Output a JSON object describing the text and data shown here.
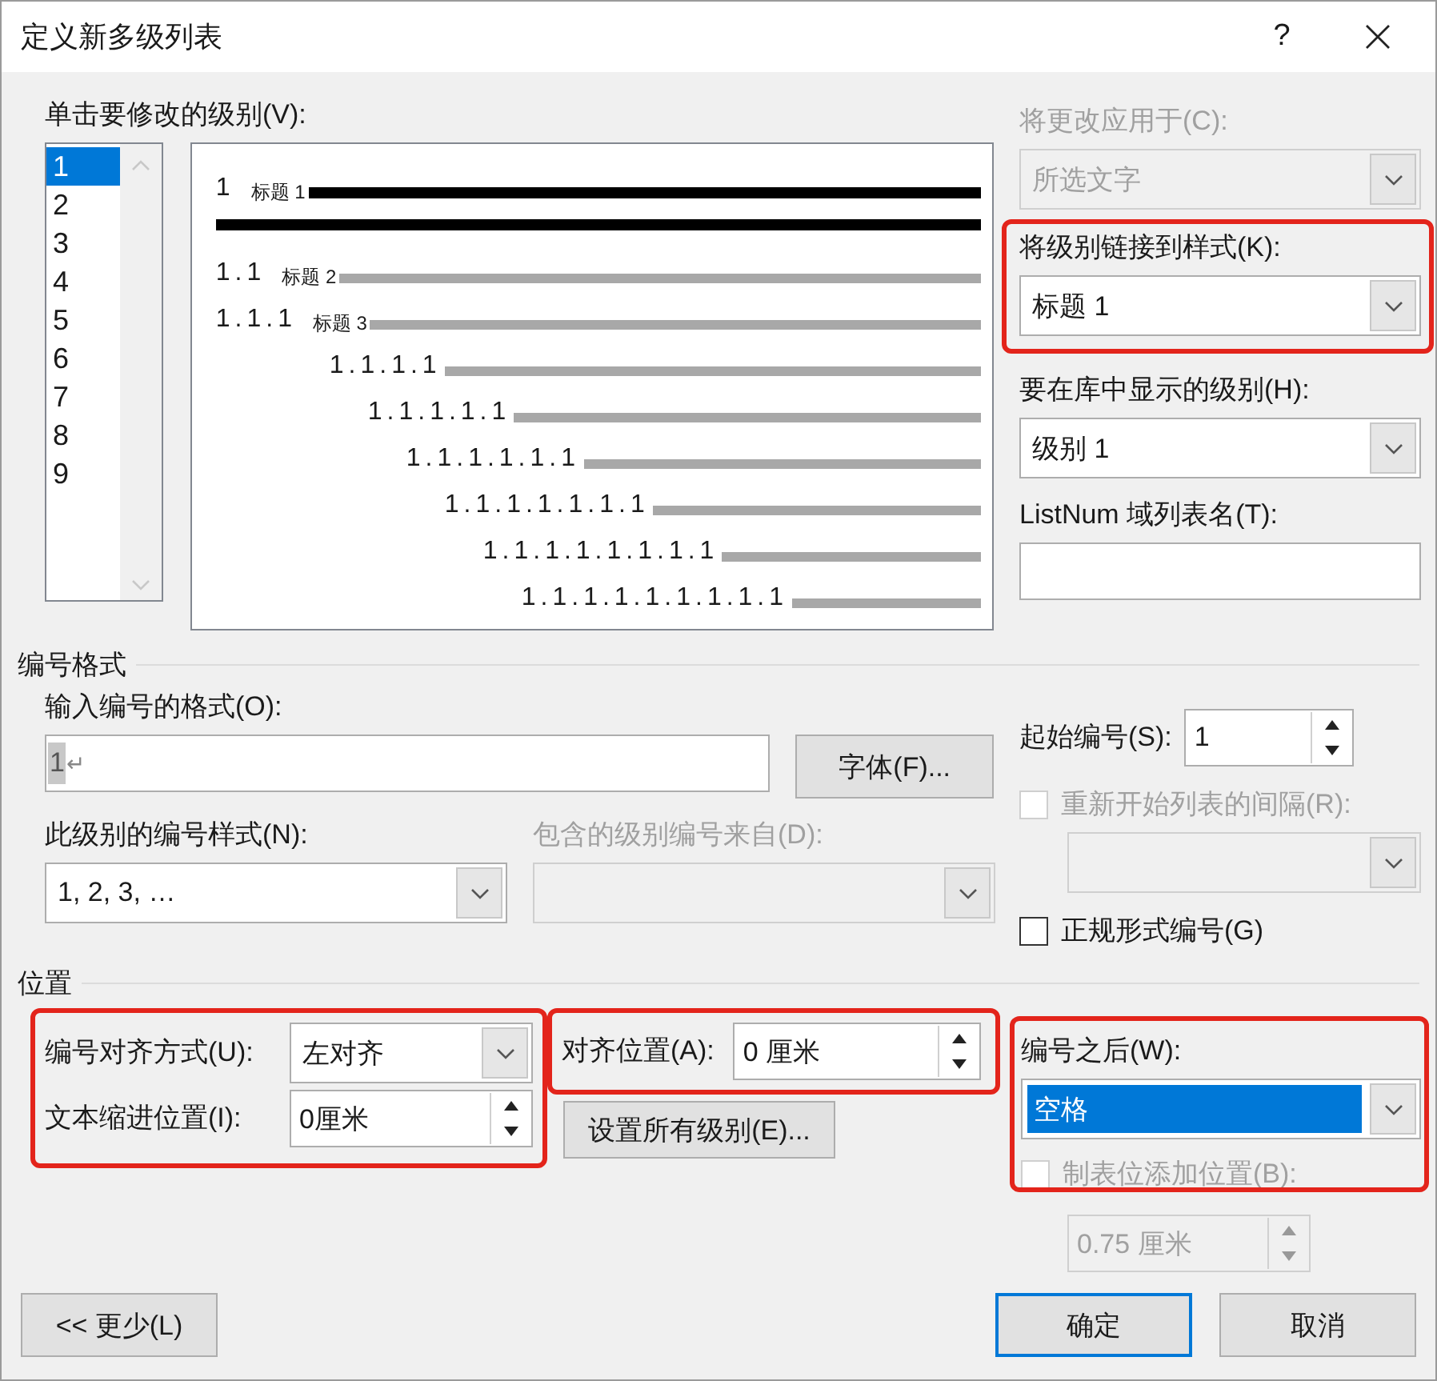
{
  "window": {
    "title": "定义新多级列表",
    "help": "?"
  },
  "levels": {
    "label": "单击要修改的级别(V):",
    "items": [
      {
        "label": "1",
        "selected": true
      },
      {
        "label": "2",
        "selected": false
      },
      {
        "label": "3",
        "selected": false
      },
      {
        "label": "4",
        "selected": false
      },
      {
        "label": "5",
        "selected": false
      },
      {
        "label": "6",
        "selected": false
      },
      {
        "label": "7",
        "selected": false
      },
      {
        "label": "8",
        "selected": false
      },
      {
        "label": "9",
        "selected": false
      }
    ]
  },
  "preview": {
    "rows": [
      {
        "number": "1",
        "style": "标题 1",
        "selected": true
      },
      {
        "number": "1.1",
        "style": "标题 2",
        "selected": false
      },
      {
        "number": "1.1.1",
        "style": "标题 3",
        "selected": false
      },
      {
        "number": "1.1.1.1",
        "selected": false
      },
      {
        "number": "1.1.1.1.1",
        "selected": false
      },
      {
        "number": "1.1.1.1.1.1",
        "selected": false
      },
      {
        "number": "1.1.1.1.1.1.1",
        "selected": false
      },
      {
        "number": "1.1.1.1.1.1.1.1",
        "selected": false
      },
      {
        "number": "1.1.1.1.1.1.1.1.1",
        "selected": false
      }
    ]
  },
  "apply_to": {
    "label": "将更改应用于(C):",
    "value": "所选文字",
    "disabled": true
  },
  "link_style": {
    "label": "将级别链接到样式(K):",
    "value": "标题 1",
    "highlighted": true
  },
  "gallery_level": {
    "label": "要在库中显示的级别(H):",
    "value": "级别 1"
  },
  "listnum": {
    "label": "ListNum 域列表名(T):"
  },
  "number_format": {
    "title": "编号格式",
    "format_label": "输入编号的格式(O):",
    "format_value": "1",
    "format_mark": "↵",
    "font_button": "字体(F)...",
    "style_label": "此级别的编号样式(N):",
    "style_value": "1, 2, 3, …",
    "include_label": "包含的级别编号来自(D):",
    "include_disabled": true,
    "start_label": "起始编号(S):",
    "start_value": "1",
    "restart": {
      "label": "重新开始列表的间隔(R):",
      "checked": false,
      "disabled": true
    },
    "legal": {
      "label": "正规形式编号(G)",
      "checked": false,
      "disabled": false
    }
  },
  "position": {
    "title": "位置",
    "alignment": {
      "highlighted": true,
      "align_label": "编号对齐方式(U):",
      "align_value": "左对齐",
      "indent_label": "文本缩进位置(I):",
      "indent_value": "0厘米"
    },
    "aligned_at": {
      "highlighted": true,
      "label": "对齐位置(A):",
      "value": "0 厘米"
    },
    "set_all_button": "设置所有级别(E)...",
    "follow": {
      "highlighted": true,
      "label": "编号之后(W):",
      "value": "空格",
      "selected": true
    },
    "tab_add": {
      "label": "制表位添加位置(B):",
      "checked": false,
      "disabled": true
    },
    "tab_value": {
      "value": "0.75 厘米",
      "disabled": true
    }
  },
  "buttons": [
    {
      "label": "<< 更少(L)",
      "default": false
    },
    {
      "label": "确定",
      "default": true
    },
    {
      "label": "取消",
      "default": false
    }
  ]
}
